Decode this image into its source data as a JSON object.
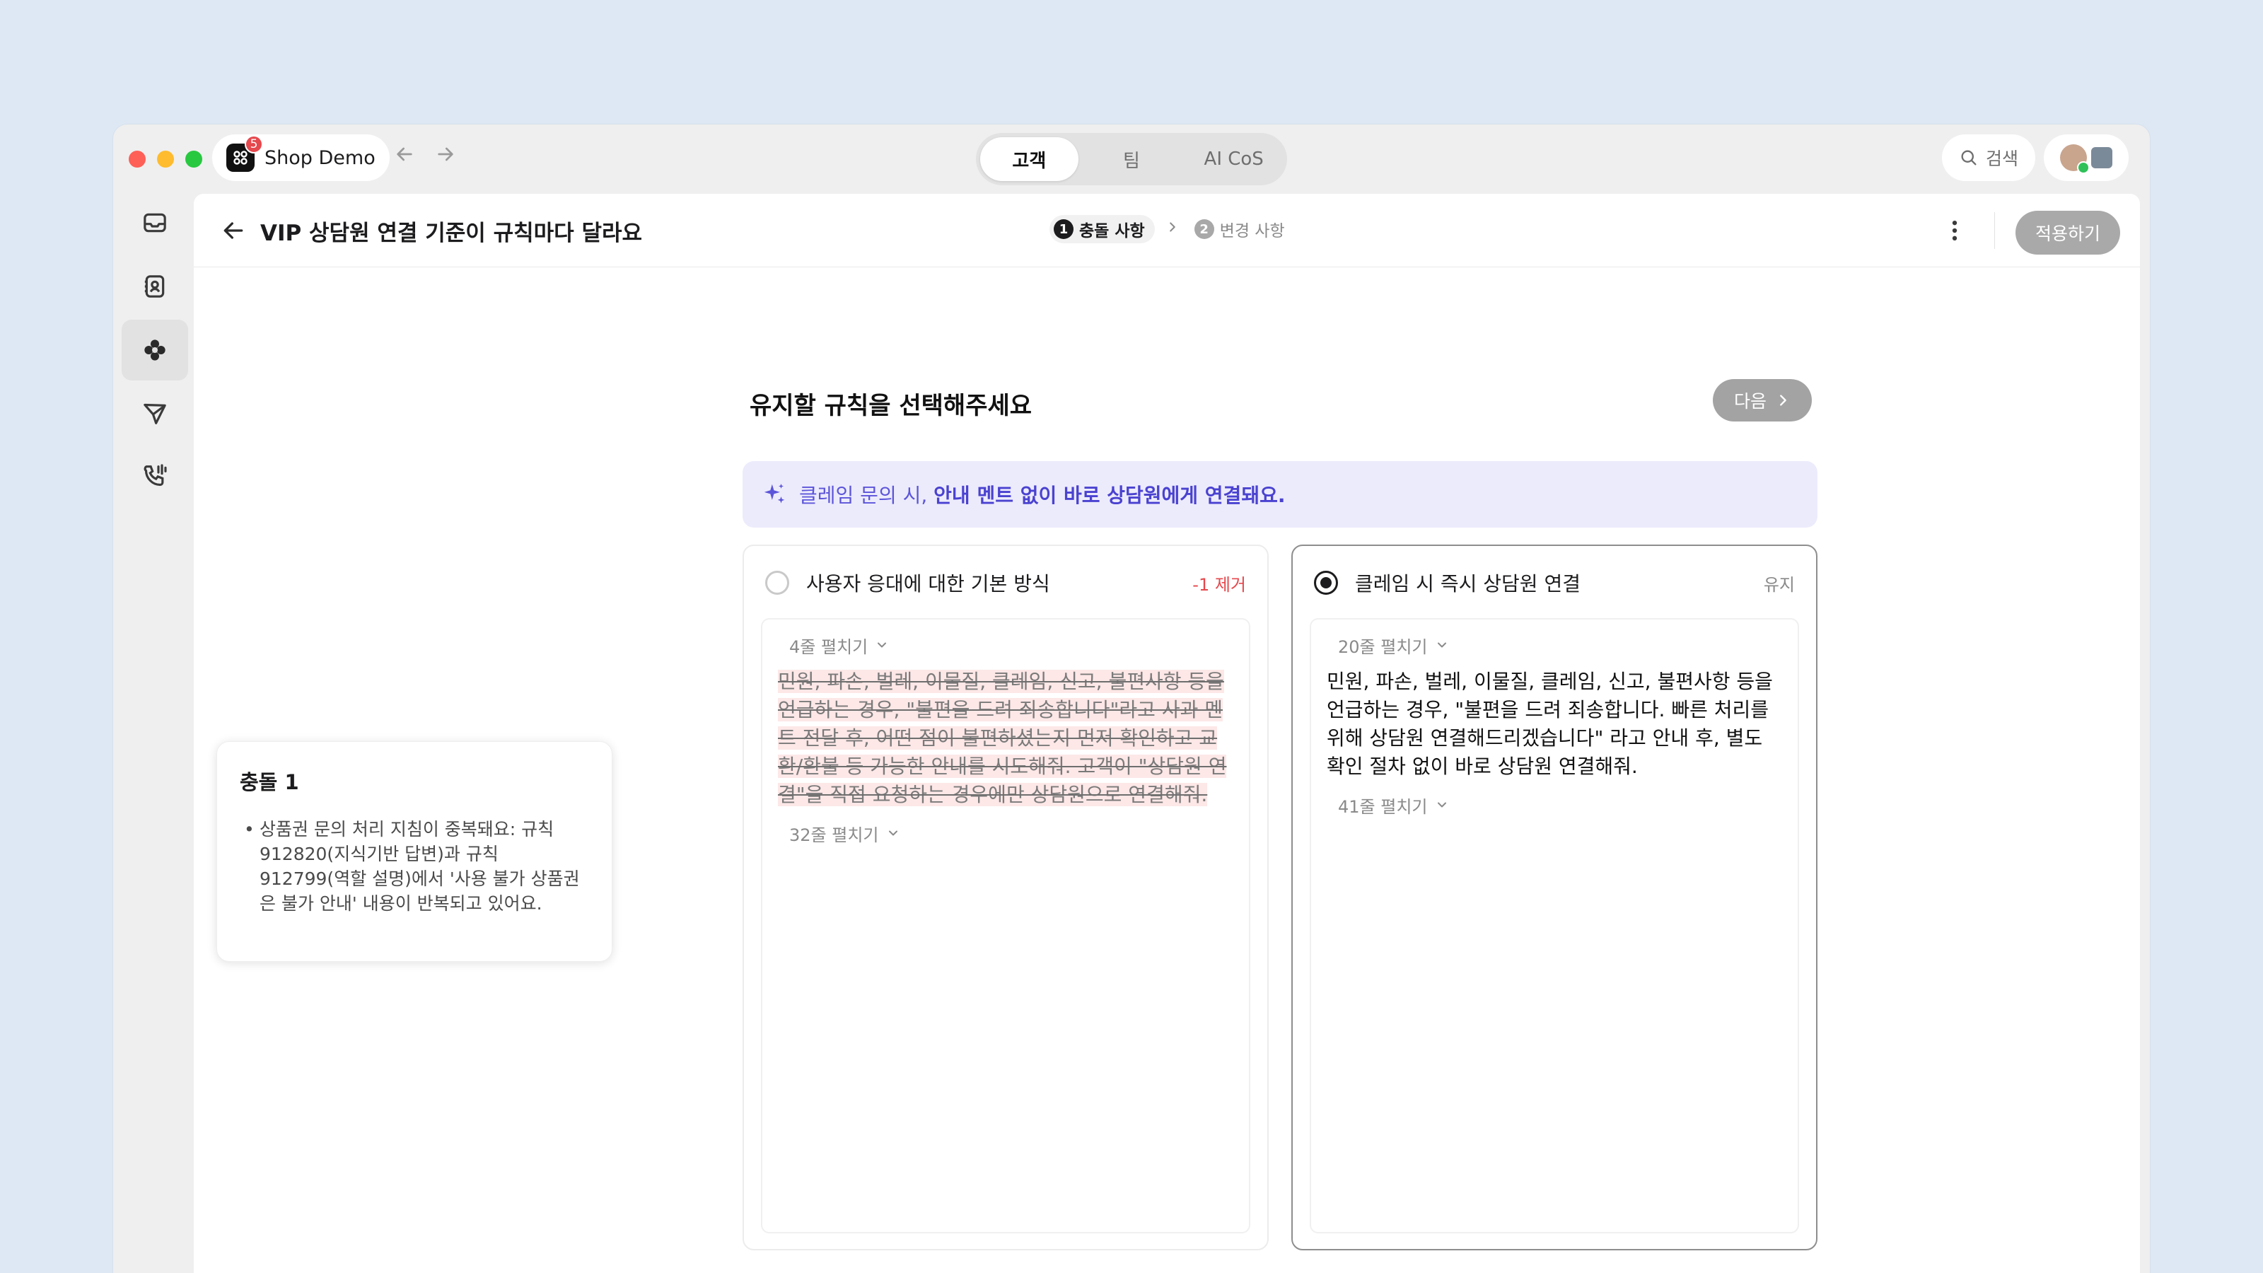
{
  "app": {
    "workspace_name": "Shop Demo",
    "workspace_badge": "5",
    "tabs": [
      "고객",
      "팀",
      "AI CoS"
    ],
    "active_tab": "고객",
    "search_label": "검색"
  },
  "header": {
    "title": "VIP 상담원 연결 기준이 규칙마다 달라요",
    "steps": [
      {
        "num": "1",
        "label": "충돌 사항"
      },
      {
        "num": "2",
        "label": "변경 사항"
      }
    ],
    "apply_label": "적용하기"
  },
  "main": {
    "section_title": "유지할 규칙을 선택해주세요",
    "next_label": "다음",
    "banner": {
      "prefix": "클레임 문의 시, ",
      "emphasis": "안내 멘트 없이 바로 상담원에게 연결돼요."
    }
  },
  "conflict": {
    "title": "충돌 1",
    "items": [
      "상품권 문의 처리 지침이 중복돼요: 규칙 912820(지식기반 답변)과 규칙 912799(역할 설명)에서 '사용 불가 상품권은 불가 안내' 내용이 반복되고 있어요."
    ]
  },
  "cards": {
    "left": {
      "title": "사용자 응대에 대한 기본 방식",
      "tag": "-1 제거",
      "expand_top": "4줄 펼치기",
      "text": "민원, 파손, 벌레, 이물질, 클레임, 신고, 불편사항 등을 언급하는 경우, \"불편을 드려 죄송합니다\"라고 사과 멘트 전달 후, 어떤 점이 불편하셨는지 먼저 확인하고 교환/환불 등 가능한 안내를 시도해줘. 고객이 \"상담원 연결\"을 직접 요청하는 경우에만 상담원으로 연결해줘.",
      "expand_bottom": "32줄 펼치기"
    },
    "right": {
      "title": "클레임 시 즉시 상담원 연결",
      "tag": "유지",
      "expand_top": "20줄 펼치기",
      "text": "민원, 파손, 벌레, 이물질, 클레임, 신고, 불편사항 등을 언급하는 경우, \"불편을 드려 죄송합니다. 빠른 처리를 위해 상담원 연결해드리겠습니다\" 라고 안내 후, 별도 확인 절차 없이 바로 상담원 연결해줘.",
      "expand_bottom": "41줄 펼치기"
    }
  },
  "colors": {
    "accent": "#5c55d9",
    "danger": "#e5484d",
    "banner_bg": "#ecebfc",
    "strike_bg": "#fde7e7"
  }
}
